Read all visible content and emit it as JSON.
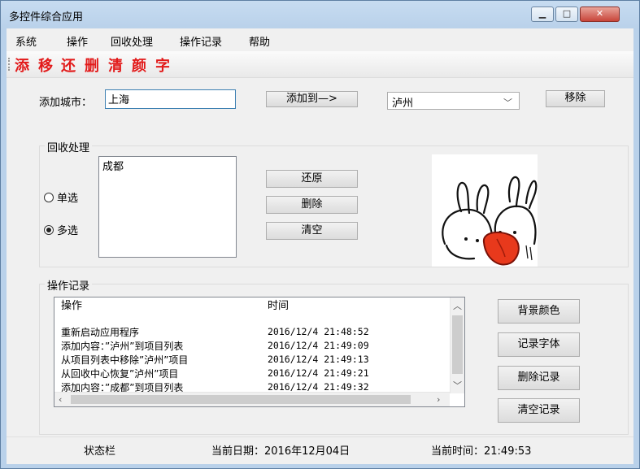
{
  "window": {
    "title": "多控件综合应用"
  },
  "menu": [
    "系统",
    "操作",
    "回收处理",
    "操作记录",
    "帮助"
  ],
  "toolbar": {
    "items": [
      "添",
      "移",
      "还",
      "删",
      "清",
      "颜",
      "字"
    ],
    "color": "#e21a1a"
  },
  "add_city": {
    "label": "添加城市：",
    "input_value": "上海",
    "add_button": "添加到—>",
    "combo_value": "泸州",
    "remove_button": "移除"
  },
  "recycle": {
    "group_title": "回收处理",
    "radio_single": "单选",
    "radio_multi": "多选",
    "radio_selected": "multi",
    "list_items": [
      "成都"
    ],
    "restore_button": "还原",
    "delete_button": "删除",
    "clear_button": "清空"
  },
  "image": {
    "icon": "rabbit-cartoon-icon"
  },
  "log": {
    "group_title": "操作记录",
    "columns": [
      "操作",
      "时间"
    ],
    "rows": [
      {
        "action": "重新启动应用程序",
        "time": "2016/12/4 21:48:52"
      },
      {
        "action": "添加内容：”泸州”到项目列表",
        "time": "2016/12/4 21:49:09"
      },
      {
        "action": "从项目列表中移除”泸州”项目",
        "time": "2016/12/4 21:49:13"
      },
      {
        "action": "从回收中心恢复”泸州”项目",
        "time": "2016/12/4 21:49:21"
      },
      {
        "action": "添加内容：”成都”到项目列表",
        "time": "2016/12/4 21:49:32"
      }
    ],
    "bg_color_button": "背景颜色",
    "font_button": "记录字体",
    "delete_button": "删除记录",
    "clear_button": "清空记录"
  },
  "status": {
    "label": "状态栏",
    "date": "当前日期：2016年12月04日",
    "time": "当前时间：21:49:53"
  }
}
